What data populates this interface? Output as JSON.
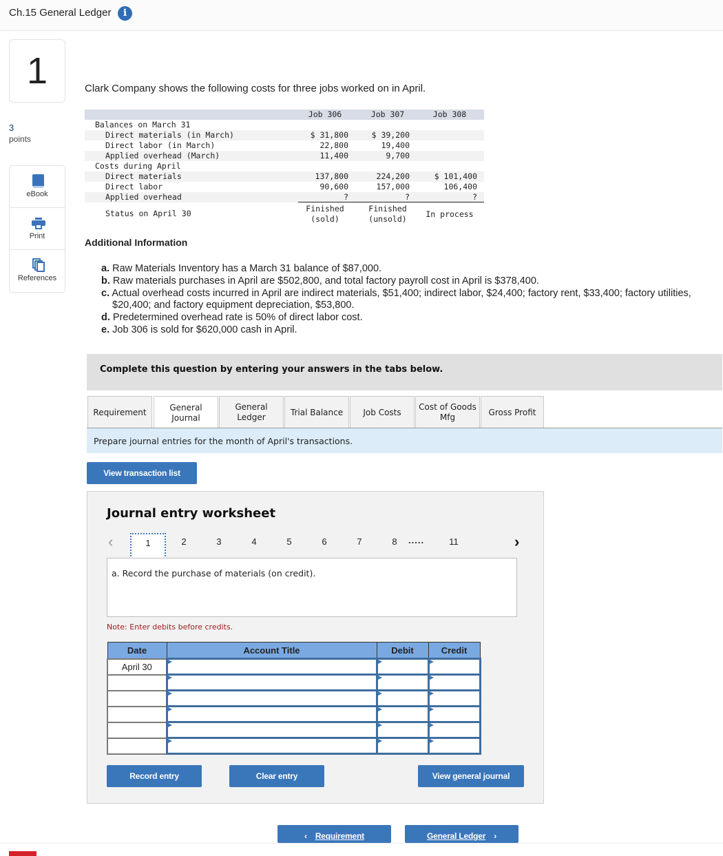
{
  "header": {
    "title": "Ch.15 General Ledger",
    "info_icon": "info-icon"
  },
  "question": {
    "number": "1",
    "points_value": "3",
    "points_label": "points"
  },
  "side_tools": [
    {
      "label": "eBook",
      "icon": "book-icon"
    },
    {
      "label": "Print",
      "icon": "printer-icon"
    },
    {
      "label": "References",
      "icon": "documents-icon"
    }
  ],
  "intro": "Clark Company shows the following costs for three jobs worked on in April.",
  "cost_table": {
    "headers": [
      "Job 306",
      "Job 307",
      "Job 308"
    ],
    "rows": [
      {
        "label": "Balances on March 31",
        "indent": false,
        "values": [
          "",
          "",
          ""
        ]
      },
      {
        "label": "Direct materials (in March)",
        "indent": true,
        "values": [
          "$ 31,800",
          "$ 39,200",
          ""
        ]
      },
      {
        "label": "Direct labor (in March)",
        "indent": true,
        "values": [
          "22,800",
          "19,400",
          ""
        ]
      },
      {
        "label": "Applied overhead (March)",
        "indent": true,
        "values": [
          "11,400",
          "9,700",
          ""
        ]
      },
      {
        "label": "Costs during April",
        "indent": false,
        "values": [
          "",
          "",
          ""
        ]
      },
      {
        "label": "Direct materials",
        "indent": true,
        "values": [
          "137,800",
          "224,200",
          "$ 101,400"
        ]
      },
      {
        "label": "Direct labor",
        "indent": true,
        "values": [
          "90,600",
          "157,000",
          "106,400"
        ]
      },
      {
        "label": "Applied overhead",
        "indent": true,
        "values": [
          "?",
          "?",
          "?"
        ]
      }
    ],
    "status_label": "Status on April 30",
    "status": [
      "Finished\n(sold)",
      "Finished\n(unsold)",
      "In process"
    ]
  },
  "additional_info": {
    "title": "Additional Information",
    "items": [
      {
        "letter": "a.",
        "text": "Raw Materials Inventory has a March 31 balance of $87,000."
      },
      {
        "letter": "b.",
        "text": "Raw materials purchases in April are $502,800, and total factory payroll cost in April is $378,400."
      },
      {
        "letter": "c.",
        "text": "Actual overhead costs incurred in April are indirect materials, $51,400; indirect labor, $24,400; factory rent, $33,400; factory utilities, $20,400; and factory equipment depreciation, $53,800."
      },
      {
        "letter": "d.",
        "text": "Predetermined overhead rate is 50% of direct labor cost."
      },
      {
        "letter": "e.",
        "text": "Job 306 is sold for $620,000 cash in April."
      }
    ]
  },
  "complete_banner": "Complete this question by entering your answers in the tabs below.",
  "tabs": [
    {
      "label": "Requirement",
      "active": false
    },
    {
      "label": "General Journal",
      "active": true
    },
    {
      "label": "General Ledger",
      "active": false
    },
    {
      "label": "Trial Balance",
      "active": false
    },
    {
      "label": "Job Costs",
      "active": false
    },
    {
      "label": "Cost of Goods Mfg",
      "active": false
    },
    {
      "label": "Gross Profit",
      "active": false
    }
  ],
  "instruction": "Prepare journal entries for the month of April's transactions.",
  "view_transaction_list": "View transaction list",
  "worksheet": {
    "title": "Journal entry worksheet",
    "pages": [
      "1",
      "2",
      "3",
      "4",
      "5",
      "6",
      "7",
      "8",
      "11"
    ],
    "active_page": "1",
    "ellipsis": ".....",
    "entry_prompt": "a. Record the purchase of materials (on credit).",
    "note": "Note: Enter debits before credits.",
    "columns": [
      "Date",
      "Account Title",
      "Debit",
      "Credit"
    ],
    "rows": [
      {
        "date": "April 30",
        "account": "",
        "debit": "",
        "credit": ""
      },
      {
        "date": "",
        "account": "",
        "debit": "",
        "credit": ""
      },
      {
        "date": "",
        "account": "",
        "debit": "",
        "credit": ""
      },
      {
        "date": "",
        "account": "",
        "debit": "",
        "credit": ""
      },
      {
        "date": "",
        "account": "",
        "debit": "",
        "credit": ""
      },
      {
        "date": "",
        "account": "",
        "debit": "",
        "credit": ""
      }
    ],
    "record_entry": "Record entry",
    "clear_entry": "Clear entry",
    "view_general_journal": "View general journal"
  },
  "nav": {
    "prev_label": "Requirement",
    "next_label": "General Ledger"
  },
  "colors": {
    "accent": "#3a76ba",
    "table_header": "#7aa9e2",
    "instruction_bg": "#dcecf9",
    "note_text": "#9b1b1b",
    "brand_red": "#d4222a"
  }
}
